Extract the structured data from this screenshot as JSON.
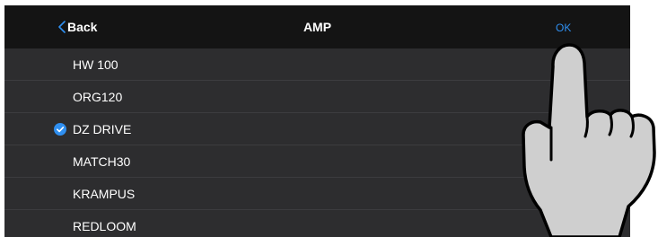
{
  "nav": {
    "back_label": "Back",
    "title": "AMP",
    "ok_label": "OK"
  },
  "amps": [
    {
      "label": "HW 100",
      "selected": false
    },
    {
      "label": "ORG120",
      "selected": false
    },
    {
      "label": "DZ DRIVE",
      "selected": true
    },
    {
      "label": "MATCH30",
      "selected": false
    },
    {
      "label": "KRAMPUS",
      "selected": false
    },
    {
      "label": "REDLOOM",
      "selected": false
    }
  ],
  "icons": {
    "back": "chevron-left-icon",
    "selected": "check-circle-icon",
    "gesture": "pointing-hand-icon"
  },
  "colors": {
    "nav_background": "#141414",
    "list_background": "#2d2d2f",
    "accent": "#2f8ff0",
    "text": "#ffffff"
  }
}
